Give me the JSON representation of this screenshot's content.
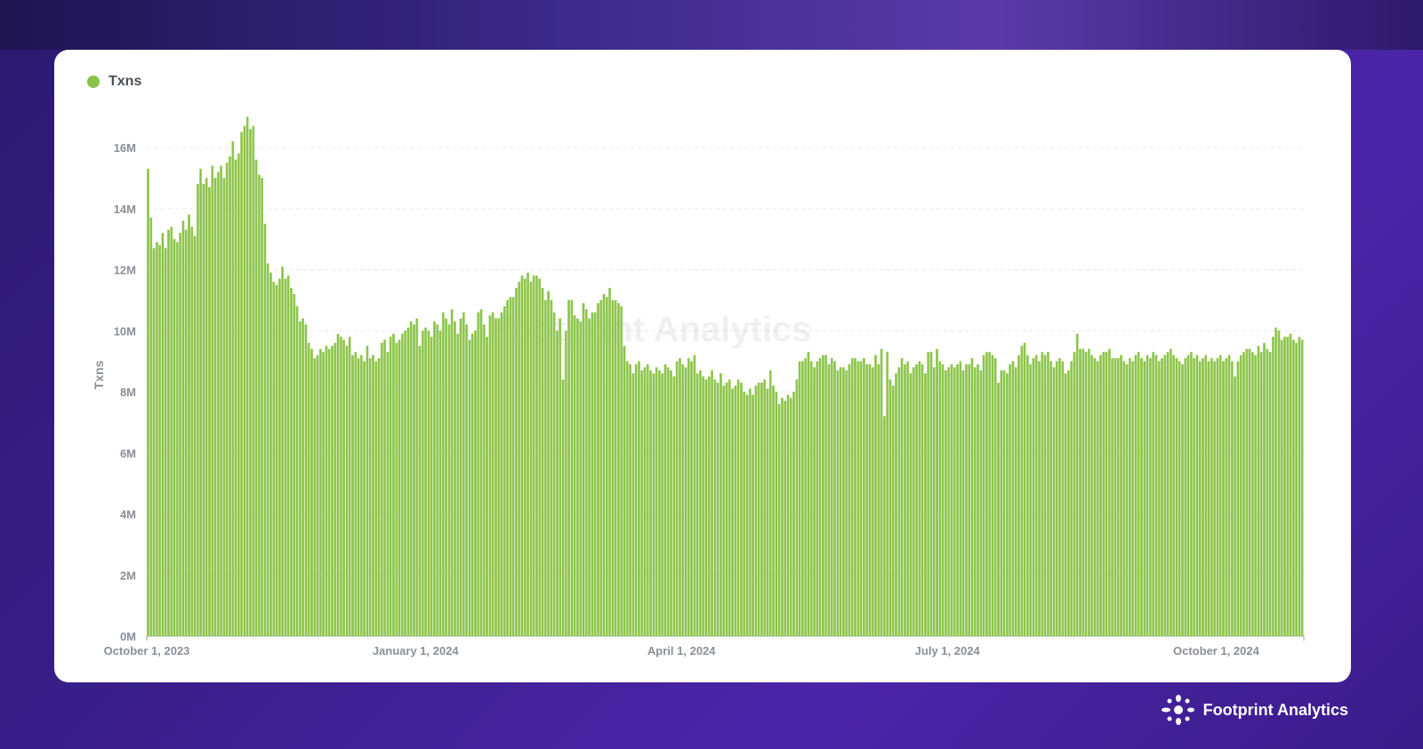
{
  "legend": {
    "label": "Txns",
    "color": "#8bc34a"
  },
  "watermark": "Footprint Analytics",
  "footer": {
    "brand": "Footprint Analytics"
  },
  "chart_data": {
    "type": "bar",
    "title": "",
    "xlabel": "",
    "ylabel": "Txns",
    "ylim": [
      0,
      16
    ],
    "y_unit": "M",
    "grid": true,
    "legend_position": "top-left",
    "start_date": "2023-10-01",
    "y_ticks": [
      "0M",
      "2M",
      "4M",
      "6M",
      "8M",
      "10M",
      "12M",
      "14M",
      "16M"
    ],
    "x_ticks": [
      {
        "label": "October 1, 2023",
        "day": 0
      },
      {
        "label": "January 1, 2024",
        "day": 92
      },
      {
        "label": "April 1, 2024",
        "day": 183
      },
      {
        "label": "July 1, 2024",
        "day": 274
      },
      {
        "label": "October 1, 2024",
        "day": 366
      }
    ],
    "series": [
      {
        "name": "Txns",
        "unit": "millions per day",
        "values": [
          15.3,
          13.7,
          12.7,
          12.9,
          12.8,
          13.2,
          12.7,
          13.3,
          13.4,
          13.0,
          12.9,
          13.2,
          13.6,
          13.3,
          13.8,
          13.4,
          13.1,
          14.8,
          15.3,
          14.8,
          15.0,
          14.7,
          15.4,
          15.0,
          15.2,
          15.4,
          15.0,
          15.5,
          15.7,
          16.2,
          15.6,
          15.8,
          16.5,
          16.7,
          17.0,
          16.6,
          16.7,
          15.6,
          15.1,
          15.0,
          13.5,
          12.2,
          11.9,
          11.6,
          11.5,
          11.7,
          12.1,
          11.7,
          11.8,
          11.4,
          11.2,
          10.8,
          10.3,
          10.4,
          10.2,
          9.6,
          9.4,
          9.1,
          9.2,
          9.4,
          9.3,
          9.5,
          9.4,
          9.5,
          9.6,
          9.9,
          9.8,
          9.7,
          9.5,
          9.8,
          9.2,
          9.3,
          9.1,
          9.2,
          9.0,
          9.5,
          9.1,
          9.2,
          9.0,
          9.1,
          9.6,
          9.7,
          9.3,
          9.8,
          9.9,
          9.6,
          9.7,
          9.9,
          10.0,
          10.1,
          10.3,
          10.2,
          10.4,
          9.5,
          10.0,
          10.1,
          10.0,
          9.8,
          10.3,
          10.2,
          10.0,
          10.6,
          10.4,
          10.2,
          10.7,
          10.3,
          9.9,
          10.4,
          10.6,
          10.2,
          9.7,
          9.9,
          10.0,
          10.6,
          10.7,
          10.2,
          9.8,
          10.5,
          10.6,
          10.4,
          10.4,
          10.6,
          10.8,
          11.0,
          11.1,
          11.1,
          11.4,
          11.6,
          11.8,
          11.7,
          11.9,
          11.6,
          11.8,
          11.8,
          11.7,
          11.4,
          11.0,
          11.3,
          11.0,
          10.6,
          10.0,
          10.4,
          8.4,
          10.0,
          11.0,
          11.0,
          10.5,
          10.4,
          10.3,
          10.9,
          10.7,
          10.4,
          10.6,
          10.6,
          10.9,
          11.0,
          11.2,
          11.1,
          11.4,
          11.0,
          11.0,
          10.9,
          10.8,
          9.5,
          9.0,
          8.9,
          8.6,
          8.9,
          9.0,
          8.7,
          8.8,
          8.9,
          8.7,
          8.6,
          8.8,
          8.7,
          8.6,
          8.9,
          8.8,
          8.7,
          8.5,
          9.0,
          9.1,
          8.9,
          8.8,
          9.1,
          9.0,
          9.2,
          8.6,
          8.7,
          8.5,
          8.4,
          8.5,
          8.7,
          8.4,
          8.3,
          8.6,
          8.2,
          8.3,
          8.4,
          8.1,
          8.2,
          8.4,
          8.3,
          8.0,
          7.9,
          8.1,
          7.9,
          8.2,
          8.3,
          8.3,
          8.4,
          8.1,
          8.7,
          8.2,
          8.0,
          7.6,
          7.8,
          7.7,
          7.9,
          7.8,
          8.0,
          8.4,
          9.0,
          9.0,
          9.1,
          9.3,
          9.0,
          8.8,
          9.0,
          9.1,
          9.2,
          9.2,
          8.9,
          9.1,
          9.0,
          8.7,
          8.8,
          8.8,
          8.7,
          8.9,
          9.1,
          9.1,
          9.0,
          9.0,
          9.1,
          8.9,
          8.9,
          8.8,
          9.2,
          8.9,
          9.4,
          7.2,
          9.3,
          8.4,
          8.2,
          8.6,
          8.8,
          9.1,
          8.9,
          9.0,
          8.6,
          8.8,
          8.9,
          9.0,
          8.9,
          8.6,
          9.3,
          9.3,
          8.8,
          9.4,
          9.0,
          8.9,
          8.7,
          8.8,
          8.9,
          8.8,
          8.9,
          9.0,
          8.7,
          8.9,
          8.9,
          9.1,
          8.8,
          8.9,
          8.7,
          9.2,
          9.3,
          9.3,
          9.2,
          9.1,
          8.3,
          8.7,
          8.7,
          8.6,
          8.9,
          9.0,
          8.8,
          9.2,
          9.5,
          9.6,
          9.2,
          8.9,
          9.1,
          9.2,
          9.0,
          9.3,
          9.2,
          9.3,
          9.0,
          8.8,
          9.0,
          9.1,
          9.0,
          8.6,
          8.7,
          9.0,
          9.3,
          9.9,
          9.4,
          9.4,
          9.3,
          9.4,
          9.2,
          9.1,
          9.0,
          9.2,
          9.3,
          9.3,
          9.4,
          9.1,
          9.1,
          9.1,
          9.2,
          9.0,
          8.9,
          9.1,
          9.0,
          9.2,
          9.3,
          9.1,
          9.0,
          9.2,
          9.1,
          9.3,
          9.2,
          9.0,
          9.1,
          9.2,
          9.3,
          9.4,
          9.2,
          9.1,
          9.0,
          8.9,
          9.1,
          9.2,
          9.3,
          9.1,
          9.2,
          9.0,
          9.1,
          9.2,
          9.0,
          9.1,
          9.0,
          9.1,
          9.2,
          9.0,
          9.1,
          9.2,
          9.0,
          8.5,
          9.0,
          9.2,
          9.3,
          9.4,
          9.4,
          9.3,
          9.2,
          9.5,
          9.3,
          9.6,
          9.4,
          9.3,
          9.8,
          10.1,
          10.0,
          9.7,
          9.8,
          9.8,
          9.9,
          9.7,
          9.6,
          9.8,
          9.7
        ]
      }
    ]
  }
}
